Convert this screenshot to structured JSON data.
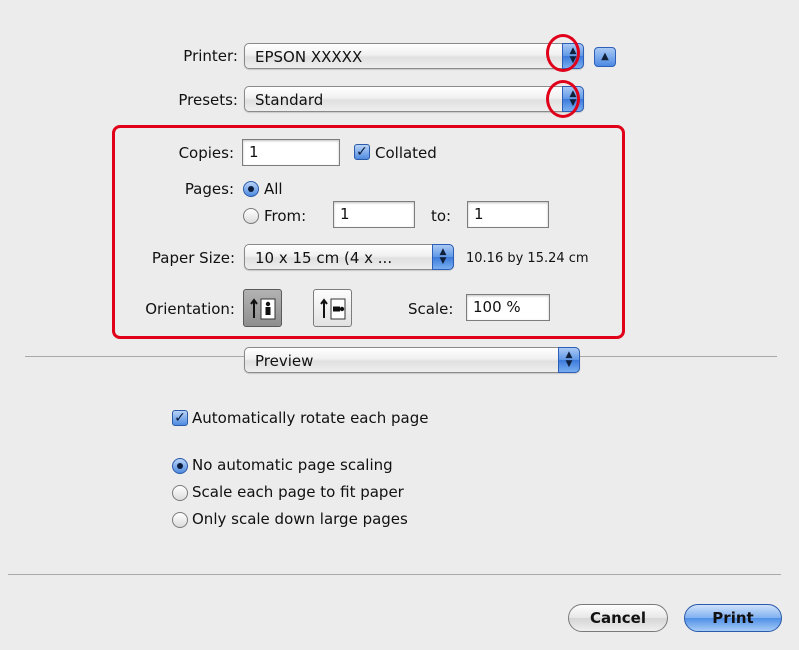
{
  "printer": {
    "label": "Printer:",
    "value": "EPSON XXXXX"
  },
  "presets": {
    "label": "Presets:",
    "value": "Standard"
  },
  "copies": {
    "label": "Copies:",
    "value": "1",
    "collated_label": "Collated",
    "collated_checked": true
  },
  "pages": {
    "label": "Pages:",
    "all_label": "All",
    "from_label": "From:",
    "from_value": "1",
    "to_label": "to:",
    "to_value": "1",
    "selected": "all"
  },
  "paper_size": {
    "label": "Paper Size:",
    "value": "10 x 15 cm (4 x ...",
    "dimensions": "10.16 by 15.24 cm"
  },
  "orientation": {
    "label": "Orientation:",
    "selected": "portrait"
  },
  "scale": {
    "label": "Scale:",
    "value": "100 %"
  },
  "section_popup": {
    "value": "Preview"
  },
  "auto_rotate": {
    "label": "Automatically rotate each page",
    "checked": true
  },
  "scaling_options": [
    {
      "label": "No automatic page scaling",
      "selected": true
    },
    {
      "label": "Scale each page to fit paper",
      "selected": false
    },
    {
      "label": "Only scale down large pages",
      "selected": false
    }
  ],
  "buttons": {
    "cancel": "Cancel",
    "print": "Print"
  },
  "colors": {
    "highlight_red": "#e0001a",
    "accent_blue": "#4f8be0"
  },
  "icons": {
    "popup_stepper": "up-down-arrows-icon",
    "disclosure": "triangle-up-icon"
  }
}
